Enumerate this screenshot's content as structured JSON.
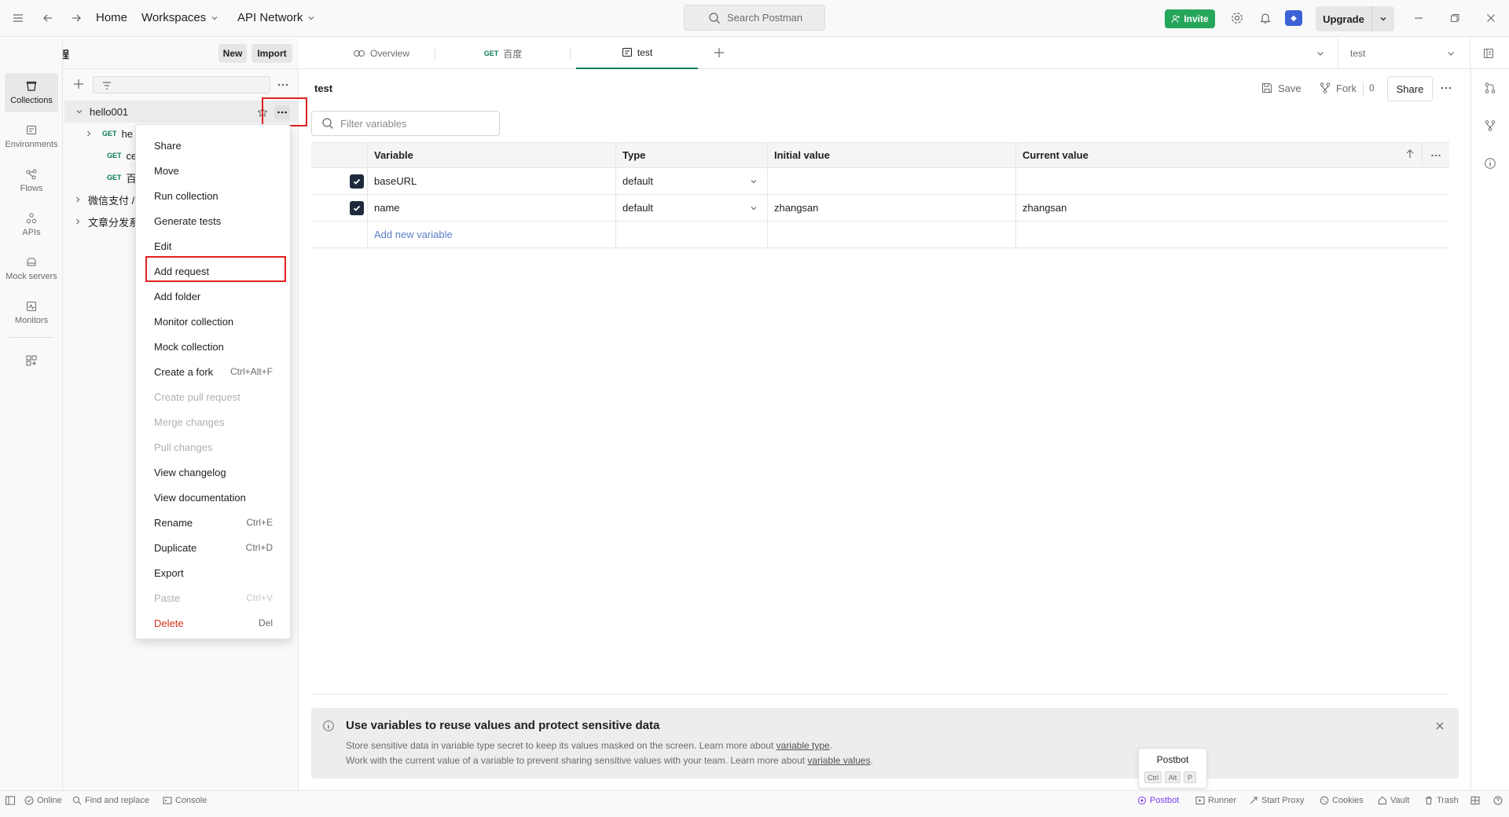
{
  "topbar": {
    "home": "Home",
    "workspaces": "Workspaces",
    "api_network": "API Network",
    "search_placeholder": "Search Postman",
    "invite": "Invite",
    "upgrade": "Upgrade"
  },
  "workspace": {
    "name": "恩格编程",
    "new_label": "New",
    "import_label": "Import"
  },
  "rail": [
    {
      "label": "Collections",
      "icon": "collections-icon"
    },
    {
      "label": "Environments",
      "icon": "environments-icon"
    },
    {
      "label": "Flows",
      "icon": "flows-icon"
    },
    {
      "label": "APIs",
      "icon": "apis-icon"
    },
    {
      "label": "Mock servers",
      "icon": "mock-servers-icon"
    },
    {
      "label": "Monitors",
      "icon": "monitors-icon"
    }
  ],
  "sidebar": {
    "collection": "hello001",
    "requests": [
      {
        "method": "GET",
        "name": "he"
      },
      {
        "method": "GET",
        "name": "ce"
      },
      {
        "method": "GET",
        "name": "百"
      }
    ],
    "other_collections": [
      "微信支付 /",
      "文章分发系"
    ]
  },
  "context_menu": [
    {
      "label": "Share",
      "shortcut": "",
      "state": "normal"
    },
    {
      "label": "Move",
      "shortcut": "",
      "state": "normal"
    },
    {
      "label": "Run collection",
      "shortcut": "",
      "state": "normal"
    },
    {
      "label": "Generate tests",
      "shortcut": "",
      "state": "normal"
    },
    {
      "label": "Edit",
      "shortcut": "",
      "state": "normal"
    },
    {
      "label": "Add request",
      "shortcut": "",
      "state": "normal"
    },
    {
      "label": "Add folder",
      "shortcut": "",
      "state": "normal"
    },
    {
      "label": "Monitor collection",
      "shortcut": "",
      "state": "normal"
    },
    {
      "label": "Mock collection",
      "shortcut": "",
      "state": "normal"
    },
    {
      "label": "Create a fork",
      "shortcut": "Ctrl+Alt+F",
      "state": "normal"
    },
    {
      "label": "Create pull request",
      "shortcut": "",
      "state": "disabled"
    },
    {
      "label": "Merge changes",
      "shortcut": "",
      "state": "disabled"
    },
    {
      "label": "Pull changes",
      "shortcut": "",
      "state": "disabled"
    },
    {
      "label": "View changelog",
      "shortcut": "",
      "state": "normal"
    },
    {
      "label": "View documentation",
      "shortcut": "",
      "state": "normal"
    },
    {
      "label": "Rename",
      "shortcut": "Ctrl+E",
      "state": "normal"
    },
    {
      "label": "Duplicate",
      "shortcut": "Ctrl+D",
      "state": "normal"
    },
    {
      "label": "Export",
      "shortcut": "",
      "state": "normal"
    },
    {
      "label": "Paste",
      "shortcut": "Ctrl+V",
      "state": "disabled"
    },
    {
      "label": "Delete",
      "shortcut": "Del",
      "state": "danger"
    }
  ],
  "tabs": {
    "overview": "Overview",
    "req_method": "GET",
    "req_name": "百度",
    "active": "test",
    "env_selected": "test"
  },
  "main": {
    "title": "test",
    "save": "Save",
    "fork": "Fork",
    "fork_count": "0",
    "share": "Share",
    "filter_placeholder": "Filter variables",
    "columns": [
      "Variable",
      "Type",
      "Initial value",
      "Current value"
    ],
    "rows": [
      {
        "variable": "baseURL",
        "type": "default",
        "initial": "",
        "current": ""
      },
      {
        "variable": "name",
        "type": "default",
        "initial": "zhangsan",
        "current": "zhangsan"
      }
    ],
    "add_variable": "Add new variable"
  },
  "banner": {
    "title": "Use variables to reuse values and protect sensitive data",
    "line1_prefix": "Store sensitive data in variable type secret to keep its values masked on the screen. Learn more about ",
    "line1_link": "variable type",
    "line1_suffix": ".",
    "line2_prefix": "Work with the current value of a variable to prevent sharing sensitive values with your team. Learn more about ",
    "line2_link": "variable values",
    "line2_suffix": "."
  },
  "postbot_tip": {
    "title": "Postbot",
    "keys": [
      "Ctrl",
      "Alt",
      "P"
    ]
  },
  "statusbar": {
    "online": "Online",
    "find_replace": "Find and replace",
    "console": "Console",
    "postbot": "Postbot",
    "runner": "Runner",
    "start_proxy": "Start Proxy",
    "cookies": "Cookies",
    "vault": "Vault",
    "trash": "Trash"
  },
  "colors": {
    "accent_green": "#26a65b",
    "method_green": "#0c7c59",
    "danger_red": "#d0311b",
    "highlight_red": "#e02020",
    "postbot_purple": "#7c3aed"
  }
}
